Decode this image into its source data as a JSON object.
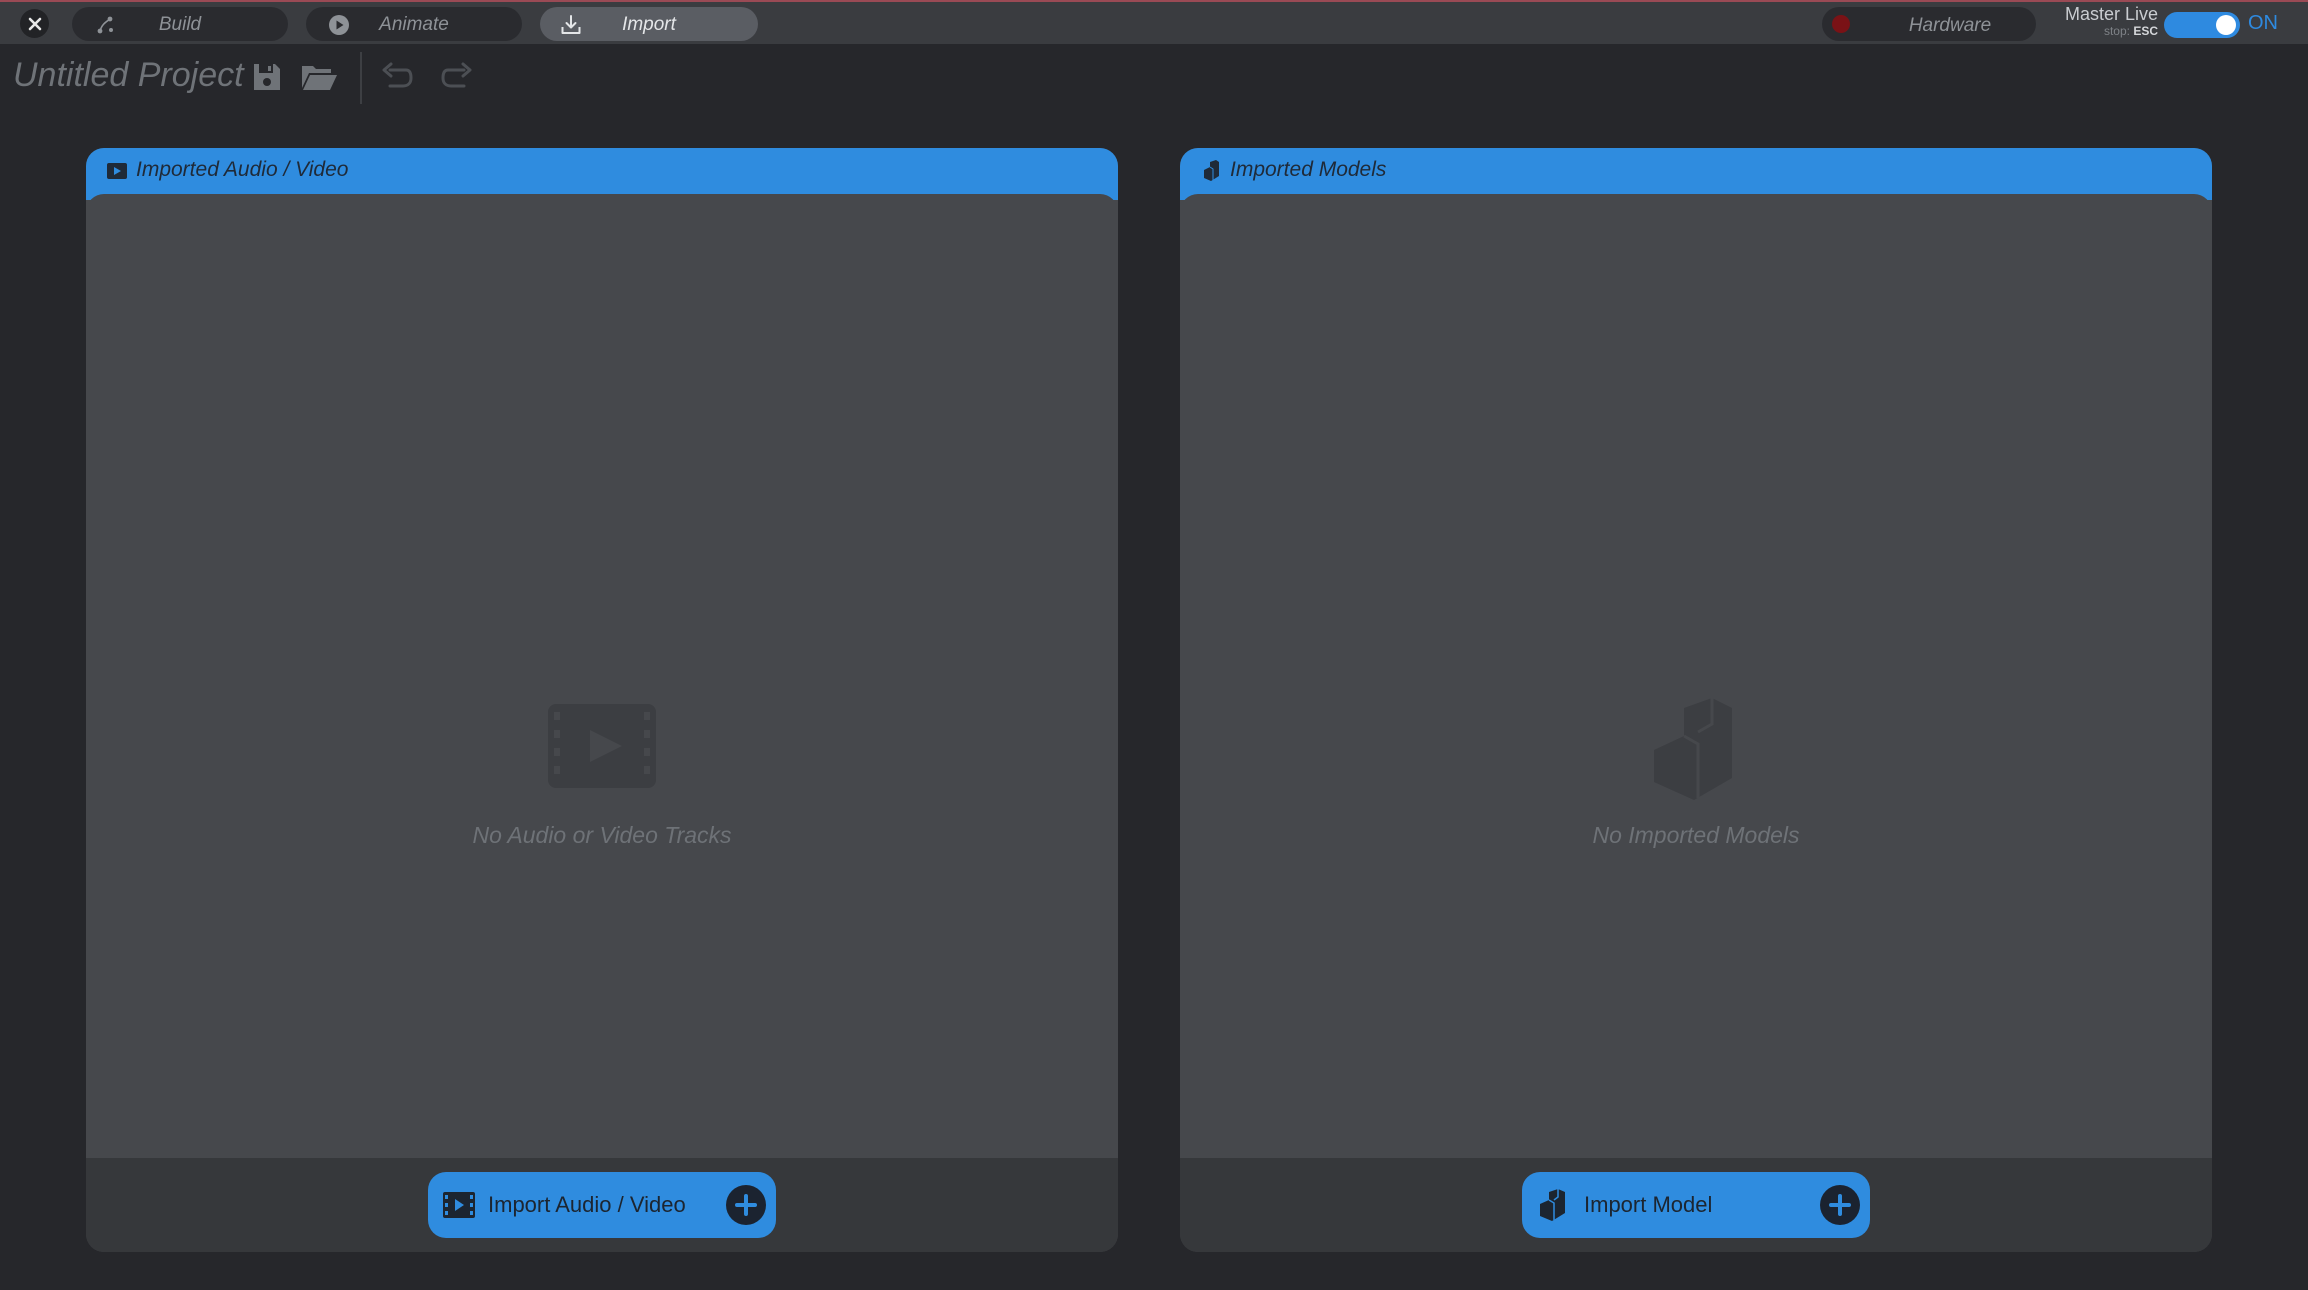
{
  "topbar": {
    "tabs": [
      {
        "label": "Build",
        "icon": "node-graph-icon",
        "active": false
      },
      {
        "label": "Animate",
        "icon": "play-circle-icon",
        "active": false
      },
      {
        "label": "Import",
        "icon": "download-icon",
        "active": true
      }
    ],
    "hardware_label": "Hardware",
    "master_live": {
      "title": "Master Live",
      "stop_prefix": "stop:",
      "stop_key": "ESC"
    },
    "toggle_label": "ON"
  },
  "project": {
    "title": "Untitled Project"
  },
  "panels": {
    "audio_video": {
      "title": "Imported Audio / Video",
      "empty_text": "No Audio or Video Tracks",
      "button_label": "Import Audio / Video"
    },
    "models": {
      "title": "Imported Models",
      "empty_text": "No Imported Models",
      "button_label": "Import Model"
    }
  },
  "colors": {
    "accent": "#2f8cdf",
    "background": "#26272b",
    "panel": "#46484c",
    "record": "#7a1216"
  }
}
